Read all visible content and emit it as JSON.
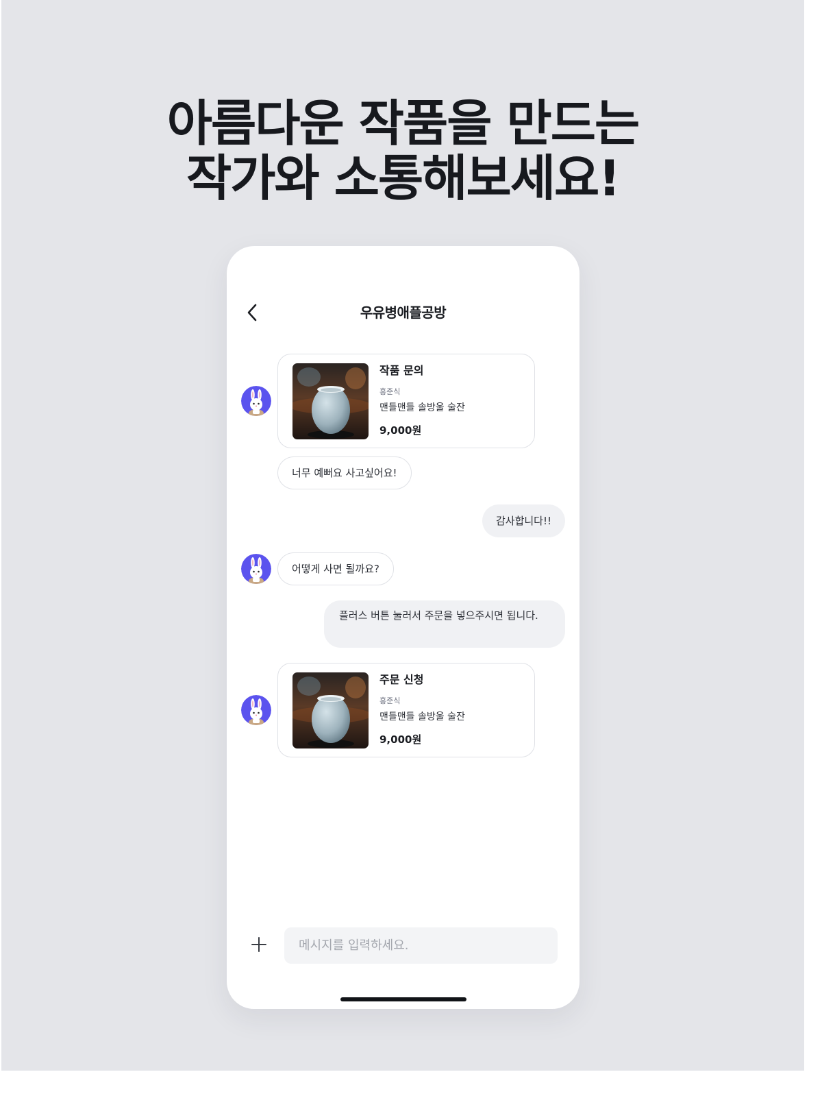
{
  "headline": {
    "line1": "아름다운 작품을 만드는",
    "line2": "작가와 소통해보세요!"
  },
  "chat": {
    "title": "우유병애플공방",
    "back_icon": "chevron-left-icon",
    "avatar_icon": "rabbit-avatar",
    "product_inquiry": {
      "title": "작품 문의",
      "artist": "홍준식",
      "product": "맨들맨들 솔방울 술잔",
      "price": "9,000원"
    },
    "msg1": "너무 예뻐요 사고싶어요!",
    "msg2": "감사합니다!!",
    "msg3": "어떻게 사면 될까요?",
    "msg4": "플러스 버튼 눌러서 주문을 넣으주시면 됩니다.",
    "order_request": {
      "title": "주문 신청",
      "artist": "홍준식",
      "product": "맨들맨들 솔방울 술잔",
      "price": "9,000원"
    }
  },
  "composer": {
    "plus_icon": "plus-icon",
    "input_value": "",
    "placeholder": "메시지를 입력하세요."
  },
  "colors": {
    "background": "#e4e5e9",
    "avatar": "#5b53ee",
    "outgoing_bubble": "#f0f1f4",
    "card_border": "#dfe1e6"
  }
}
